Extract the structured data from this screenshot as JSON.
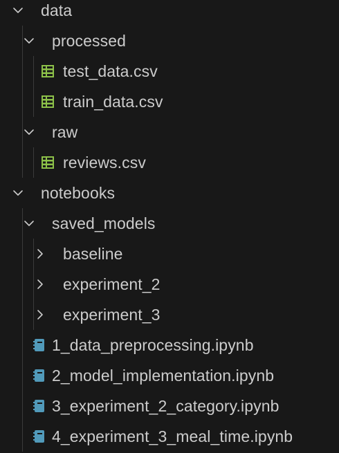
{
  "explorer": {
    "items": [
      {
        "label": "data",
        "kind": "folder",
        "expanded": true,
        "depth": 0
      },
      {
        "label": "processed",
        "kind": "folder",
        "expanded": true,
        "depth": 1
      },
      {
        "label": "test_data.csv",
        "kind": "csv",
        "depth": 2
      },
      {
        "label": "train_data.csv",
        "kind": "csv",
        "depth": 2
      },
      {
        "label": "raw",
        "kind": "folder",
        "expanded": true,
        "depth": 1
      },
      {
        "label": "reviews.csv",
        "kind": "csv",
        "depth": 2
      },
      {
        "label": "notebooks",
        "kind": "folder",
        "expanded": true,
        "depth": 0
      },
      {
        "label": "saved_models",
        "kind": "folder",
        "expanded": true,
        "depth": 1
      },
      {
        "label": "baseline",
        "kind": "folder",
        "expanded": false,
        "depth": 2
      },
      {
        "label": "experiment_2",
        "kind": "folder",
        "expanded": false,
        "depth": 2
      },
      {
        "label": "experiment_3",
        "kind": "folder",
        "expanded": false,
        "depth": 2
      },
      {
        "label": "1_data_preprocessing.ipynb",
        "kind": "notebook",
        "depth": 1
      },
      {
        "label": "2_model_implementation.ipynb",
        "kind": "notebook",
        "depth": 1
      },
      {
        "label": "3_experiment_2_category.ipynb",
        "kind": "notebook",
        "depth": 1
      },
      {
        "label": "4_experiment_3_meal_time.ipynb",
        "kind": "notebook",
        "depth": 1
      }
    ]
  },
  "icons": {
    "csv": "table-icon",
    "notebook": "notebook-icon",
    "expanded": "chevron-down-icon",
    "collapsed": "chevron-right-icon"
  },
  "colors": {
    "background": "#181818",
    "text": "#cccccc",
    "csv_icon": "#8dc149",
    "notebook_icon": "#519aba",
    "guide": "#3b3b3b"
  }
}
